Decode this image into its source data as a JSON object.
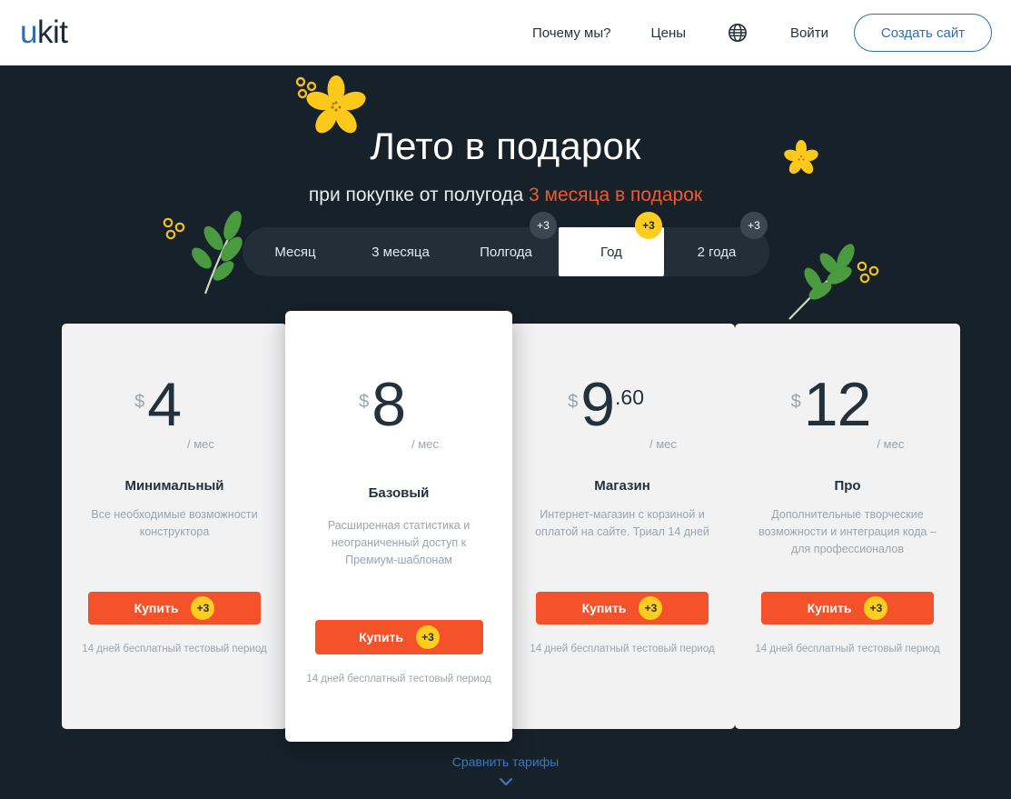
{
  "header": {
    "logo_u": "u",
    "logo_kit": "kit",
    "nav": [
      {
        "label": "Почему мы?",
        "name": "nav-why"
      },
      {
        "label": "Цены",
        "name": "nav-prices"
      },
      {
        "label": "Войти",
        "name": "nav-login"
      }
    ],
    "language_icon": "globe-icon",
    "create_site_button": "Создать сайт"
  },
  "hero": {
    "title": "Лето в подарок",
    "subtitle_prefix": "при покупке от полугода ",
    "subtitle_accent": "3 месяца в подарок",
    "accent_color": "#ef5a33",
    "background_color": "#172129",
    "decorations": [
      "flower-icon",
      "flower-icon",
      "branch-icon",
      "branch-icon"
    ]
  },
  "period_tabs": {
    "items": [
      {
        "label": "Месяц",
        "badge": null,
        "active": false
      },
      {
        "label": "3 месяца",
        "badge": null,
        "active": false
      },
      {
        "label": "Полгода",
        "badge": "+3",
        "active": false,
        "badge_style": "dark"
      },
      {
        "label": "Год",
        "badge": "+3",
        "active": true,
        "badge_style": "yellow"
      },
      {
        "label": "2 года",
        "badge": "+3",
        "active": false,
        "badge_style": "dark"
      }
    ]
  },
  "plans": [
    {
      "currency": "$",
      "amount": "4",
      "cents": "",
      "per": "/ мес",
      "name": "Минимальный",
      "description": "Все необходимые возможности конструктора",
      "buy_label": "Купить",
      "buy_badge": "+3",
      "trial": "14 дней бесплатный тестовый период",
      "featured": false
    },
    {
      "currency": "$",
      "amount": "8",
      "cents": "",
      "per": "/ мес",
      "name": "Базовый",
      "description": "Расширенная статистика и неограниченный доступ к Премиум-шаблонам",
      "buy_label": "Купить",
      "buy_badge": "+3",
      "trial": "14 дней бесплатный тестовый период",
      "featured": true
    },
    {
      "currency": "$",
      "amount": "9",
      "cents": ".60",
      "per": "/ мес",
      "name": "Магазин",
      "description": "Интернет-магазин с корзиной и оплатой на сайте. Триал 14 дней",
      "buy_label": "Купить",
      "buy_badge": "+3",
      "trial": "14 дней бесплатный тестовый период",
      "featured": false
    },
    {
      "currency": "$",
      "amount": "12",
      "cents": "",
      "per": "/ мес",
      "name": "Про",
      "description": "Дополнительные творческие возможности и интеграция кода – для профессионалов",
      "buy_label": "Купить",
      "buy_badge": "+3",
      "trial": "14 дней бесплатный тестовый период",
      "featured": false
    }
  ],
  "footer": {
    "compare_label": "Сравнить тарифы",
    "compare_icon": "chevron-down-icon",
    "link_color": "#3a78c2"
  },
  "colors": {
    "accent_orange": "#f4522a",
    "badge_yellow": "#ffcd1e",
    "brand_blue": "#2f6fab",
    "dark_bg": "#172129",
    "card_bg": "#f2f2f3"
  }
}
